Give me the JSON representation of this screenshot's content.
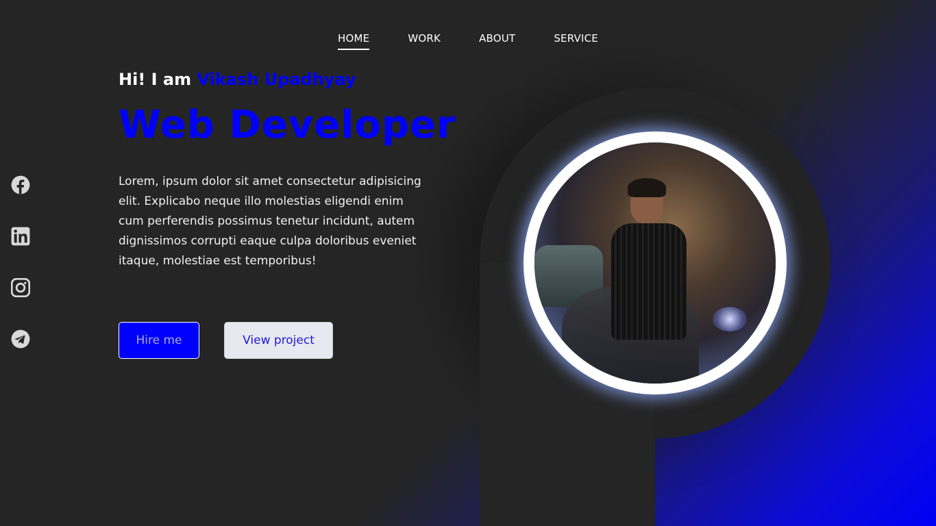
{
  "nav": {
    "items": [
      {
        "label": "HOME",
        "active": true
      },
      {
        "label": "WORK"
      },
      {
        "label": "ABOUT"
      },
      {
        "label": "SERVICE"
      }
    ]
  },
  "social": {
    "icons": [
      "facebook-icon",
      "linkedin-icon",
      "instagram-icon",
      "telegram-icon"
    ]
  },
  "hero": {
    "greeting_prefix": "Hi! I am ",
    "name": "Vikash Upadhyay",
    "title": "Web Developer",
    "description": "Lorem, ipsum dolor sit amet consectetur adipisicing elit. Explicabo neque illo molestias eligendi enim cum perferendis possimus tenetur incidunt, autem dignissimos corrupti eaque culpa doloribus eveniet itaque, molestiae est temporibus!",
    "hire_label": "Hire me",
    "view_label": "View project"
  },
  "colors": {
    "accent": "#0000ff",
    "background": "#252525",
    "ring": "#ffffff"
  }
}
